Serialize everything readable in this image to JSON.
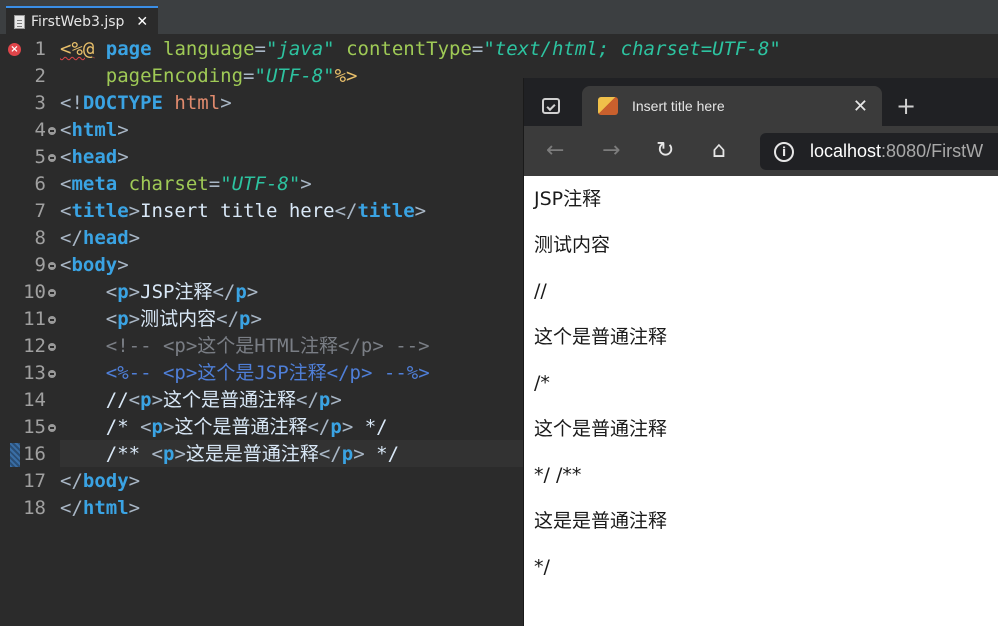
{
  "editor_tab": {
    "filename": "FirstWeb3.jsp",
    "close": "✕"
  },
  "lines": [
    {
      "n": "1",
      "fold": false
    },
    {
      "n": "2",
      "fold": false
    },
    {
      "n": "3",
      "fold": false
    },
    {
      "n": "4",
      "fold": true
    },
    {
      "n": "5",
      "fold": true
    },
    {
      "n": "6",
      "fold": false
    },
    {
      "n": "7",
      "fold": false
    },
    {
      "n": "8",
      "fold": false
    },
    {
      "n": "9",
      "fold": true
    },
    {
      "n": "10",
      "fold": true
    },
    {
      "n": "11",
      "fold": true
    },
    {
      "n": "12",
      "fold": true
    },
    {
      "n": "13",
      "fold": true
    },
    {
      "n": "14",
      "fold": false
    },
    {
      "n": "15",
      "fold": true
    },
    {
      "n": "16",
      "fold": false
    },
    {
      "n": "17",
      "fold": false
    },
    {
      "n": "18",
      "fold": false
    }
  ],
  "code": {
    "l1": {
      "open": "<%@",
      "page": "page",
      "a1": "language",
      "eq1": "=",
      "v1": "\"java\"",
      "a2": "contentType",
      "eq2": "=",
      "v2": "\"text/html; charset=UTF-8\""
    },
    "l2": {
      "indent": "    ",
      "a": "pageEncoding",
      "eq": "=",
      "v": "\"UTF-8\"",
      "close": "%>"
    },
    "l3": {
      "open": "<!",
      "doctype": "DOCTYPE",
      "sp": " ",
      "html": "html",
      "close": ">"
    },
    "l4": {
      "lt": "<",
      "tag": "html",
      "gt": ">"
    },
    "l5": {
      "lt": "<",
      "tag": "head",
      "gt": ">"
    },
    "l6": {
      "lt": "<",
      "tag": "meta",
      "sp": " ",
      "a": "charset",
      "eq": "=",
      "v": "\"UTF-8\"",
      "gt": ">"
    },
    "l7": {
      "lt": "<",
      "tag": "title",
      "gt": ">",
      "text": "Insert title here",
      "lt2": "</",
      "tag2": "title",
      "gt2": ">"
    },
    "l8": {
      "lt": "</",
      "tag": "head",
      "gt": ">"
    },
    "l9": {
      "lt": "<",
      "tag": "body",
      "gt": ">"
    },
    "l10": {
      "indent": "    ",
      "lt": "<",
      "tag": "p",
      "gt": ">",
      "text": "JSP注释",
      "lt2": "</",
      "tag2": "p",
      "gt2": ">"
    },
    "l11": {
      "indent": "    ",
      "lt": "<",
      "tag": "p",
      "gt": ">",
      "text": "测试内容",
      "lt2": "</",
      "tag2": "p",
      "gt2": ">"
    },
    "l12": {
      "indent": "    ",
      "comment": "<!-- <p>这个是HTML注释</p> -->"
    },
    "l13": {
      "indent": "    ",
      "pre": "<%-- ",
      "lt": "<",
      "tag": "p",
      "gt": ">",
      "text": "这个是JSP注释",
      "lt2": "</",
      "tag2": "p",
      "gt2": ">",
      "post": " --%>"
    },
    "l14": {
      "indent": "    ",
      "pre": "//",
      "lt": "<",
      "tag": "p",
      "gt": ">",
      "text": "这个是普通注释",
      "lt2": "</",
      "tag2": "p",
      "gt2": ">"
    },
    "l15": {
      "indent": "    ",
      "pre": "/* ",
      "lt": "<",
      "tag": "p",
      "gt": ">",
      "text": "这个是普通注释",
      "lt2": "</",
      "tag2": "p",
      "gt2": ">",
      "post": " */"
    },
    "l16": {
      "indent": "    ",
      "pre": "/** ",
      "lt": "<",
      "tag": "p",
      "gt": ">",
      "text": "这是是普通注释",
      "lt2": "</",
      "tag2": "p",
      "gt2": ">",
      "post": " */"
    },
    "l17": {
      "lt": "</",
      "tag": "body",
      "gt": ">"
    },
    "l18": {
      "lt": "</",
      "tag": "html",
      "gt": ">"
    }
  },
  "browser": {
    "tab_title": "Insert title here",
    "tab_close": "✕",
    "new_tab": "+",
    "back": "←",
    "forward": "→",
    "refresh": "↻",
    "home": "⌂",
    "info": "i",
    "url_host": "localhost",
    "url_rest": ":8080/FirstW",
    "content": [
      "JSP注释",
      "测试内容",
      "//",
      "这个是普通注释",
      "/*",
      "这个是普通注释",
      "*/ /**",
      "这是是普通注释",
      "*/"
    ]
  },
  "colors": {
    "editor_bg": "#2b2b2b",
    "tag": "#3aa3e3",
    "attribute": "#9fca56",
    "string": "#2dc3a0",
    "jsp_delimiter": "#e8bf6a",
    "html_comment": "#7a7e85",
    "jsp_comment": "#4f7fd8",
    "error": "#e0454a"
  },
  "icons": {
    "file": "file-icon",
    "error": "error-icon",
    "fold": "fold-icon",
    "browser_tab_actions": "tab-actions-icon",
    "favicon": "favicon-icon",
    "info": "info-icon"
  }
}
